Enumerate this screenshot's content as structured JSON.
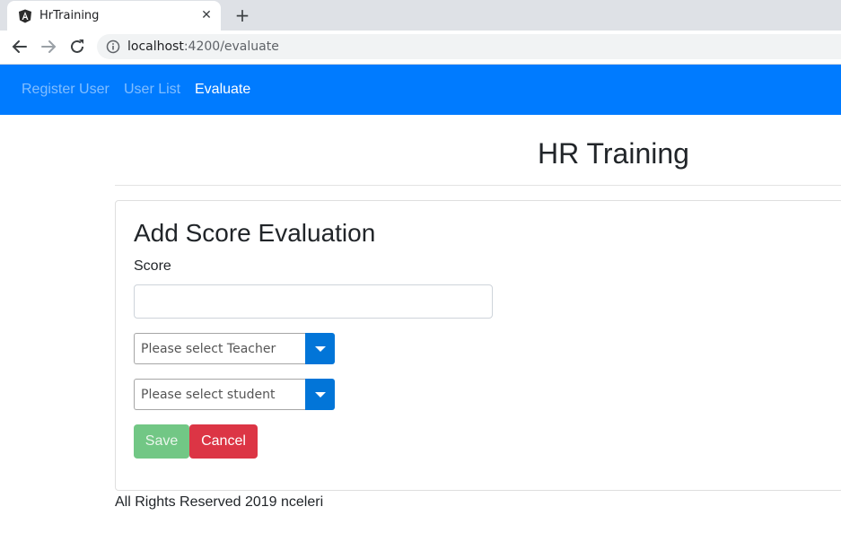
{
  "browser": {
    "tab_title": "HrTraining",
    "tab_close": "✕",
    "new_tab": "+",
    "url_host": "localhost",
    "url_rest": ":4200/evaluate"
  },
  "navbar": {
    "items": [
      {
        "label": "Register User",
        "active": false
      },
      {
        "label": "User List",
        "active": false
      },
      {
        "label": "Evaluate",
        "active": true
      }
    ],
    "color": "#007bff"
  },
  "page": {
    "title": "HR Training"
  },
  "form": {
    "title": "Add Score Evaluation",
    "score_label": "Score",
    "score_value": "",
    "teacher_placeholder": "Please select Teacher",
    "student_placeholder": "Please select student",
    "save_label": "Save",
    "cancel_label": "Cancel"
  },
  "footer": {
    "text": "All Rights Reserved 2019 nceleri"
  }
}
